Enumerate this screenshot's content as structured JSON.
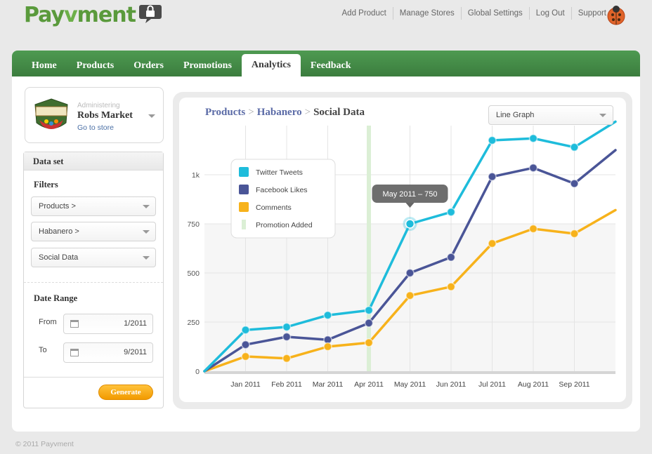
{
  "app": {
    "name_prefix": "Pay",
    "name_v": "v",
    "name_suffix": "ment"
  },
  "top_nav": [
    "Add Product",
    "Manage Stores",
    "Global Settings",
    "Log Out",
    "Support"
  ],
  "tabs": [
    "Home",
    "Products",
    "Orders",
    "Promotions",
    "Analytics",
    "Feedback"
  ],
  "active_tab": "Analytics",
  "store": {
    "administering_label": "Administering",
    "name": "Robs Market",
    "link": "Go to store"
  },
  "dataset": {
    "header": "Data set",
    "filters_label": "Filters",
    "filters": [
      "Products >",
      "Habanero >",
      "Social Data"
    ],
    "date_range_label": "Date Range",
    "from_label": "From",
    "from_value": "1/2011",
    "to_label": "To",
    "to_value": "9/2011",
    "generate_label": "Generate"
  },
  "breadcrumb": {
    "items": [
      "Products",
      "Habanero"
    ],
    "current": "Social Data",
    "separator": ">"
  },
  "graph_type": "Line Graph",
  "tooltip": "May 2011 – 750",
  "footer": "© 2011 Payvment",
  "colors": {
    "green": "#4a924d",
    "twitter": "#1ebcdb",
    "facebook": "#4a5597",
    "comments": "#f7b21b",
    "promotion": "#dbefd5",
    "orange_button": "#f5a200"
  },
  "chart_data": {
    "type": "line",
    "categories": [
      "",
      "Jan 2011",
      "Feb 2011",
      "Mar 2011",
      "Apr 2011",
      "May 2011",
      "Jun 2011",
      "Jul 2011",
      "Aug 2011",
      "Sep 2011",
      ""
    ],
    "series": [
      {
        "name": "Twitter Tweets",
        "color": "#1ebcdb",
        "values": [
          0,
          210,
          225,
          285,
          310,
          750,
          810,
          1175,
          1185,
          1140,
          1270
        ]
      },
      {
        "name": "Facebook Likes",
        "color": "#4a5597",
        "values": [
          0,
          135,
          175,
          160,
          245,
          500,
          580,
          990,
          1035,
          955,
          1125
        ]
      },
      {
        "name": "Comments",
        "color": "#f7b21b",
        "values": [
          0,
          75,
          65,
          125,
          145,
          385,
          430,
          650,
          725,
          700,
          820
        ]
      }
    ],
    "promotion": {
      "name": "Promotion Added",
      "at": "Apr 2011"
    },
    "y_ticks": [
      "0",
      "250",
      "500",
      "750",
      "1k"
    ],
    "y_tick_values": [
      0,
      250,
      500,
      750,
      1000
    ],
    "ylim": [
      0,
      1250
    ],
    "legend_position": "top-left",
    "highlight": {
      "series": "Twitter Tweets",
      "category": "May 2011",
      "value": 750
    }
  }
}
